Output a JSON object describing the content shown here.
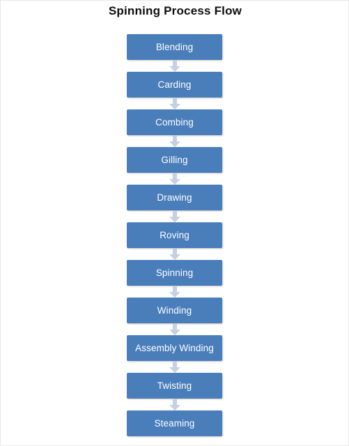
{
  "title": "Spinning Process Flow",
  "colors": {
    "background": "#ffffff",
    "box_fill": "#4a7ebb",
    "box_text": "#ffffff",
    "arrow": "#c5d0e3",
    "title_text": "#0d0d0d",
    "frame_border": "#e8e8e8"
  },
  "diagram": {
    "type": "vertical-flowchart",
    "orientation": "top-to-bottom",
    "step_count": 11,
    "arrow_count": 10,
    "arrow_icon": "arrow-down-icon",
    "steps": [
      {
        "index": 1,
        "label": "Blending"
      },
      {
        "index": 2,
        "label": "Carding"
      },
      {
        "index": 3,
        "label": "Combing"
      },
      {
        "index": 4,
        "label": "Gilling"
      },
      {
        "index": 5,
        "label": "Drawing"
      },
      {
        "index": 6,
        "label": "Roving"
      },
      {
        "index": 7,
        "label": "Spinning"
      },
      {
        "index": 8,
        "label": "Winding"
      },
      {
        "index": 9,
        "label": "Assembly Winding"
      },
      {
        "index": 10,
        "label": "Twisting"
      },
      {
        "index": 11,
        "label": "Steaming"
      }
    ]
  }
}
